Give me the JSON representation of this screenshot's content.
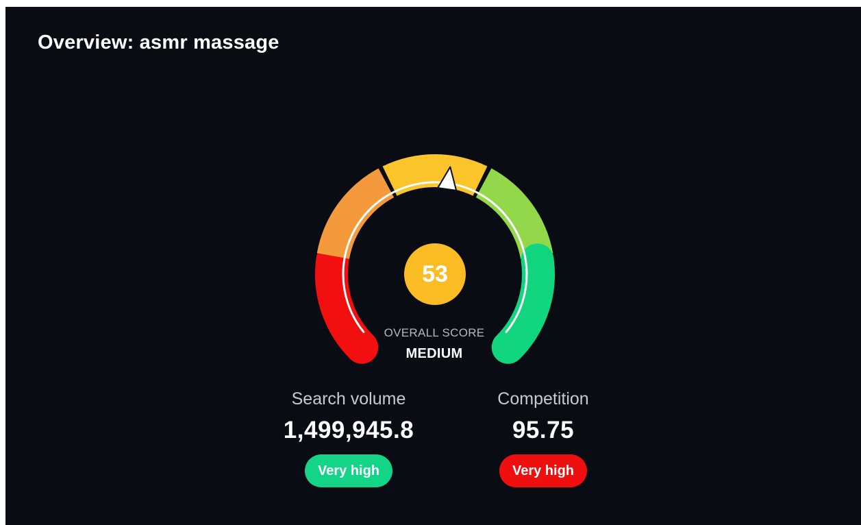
{
  "card": {
    "title": "Overview: asmr massage"
  },
  "gauge": {
    "score": "53",
    "score_value": 53,
    "score_max": 100,
    "label": "OVERALL SCORE",
    "level": "MEDIUM",
    "segment_colors": [
      "#f10f0f",
      "#f59a3c",
      "#fbc42a",
      "#93d84a",
      "#12d67f"
    ],
    "needle_color": "#ffffff",
    "score_color": "#fbbc24"
  },
  "metrics": [
    {
      "label": "Search volume",
      "value": "1,499,945.8",
      "badge": "Very high",
      "badge_color": "#14d488"
    },
    {
      "label": "Competition",
      "value": "95.75",
      "badge": "Very high",
      "badge_color": "#f00f0f"
    }
  ]
}
